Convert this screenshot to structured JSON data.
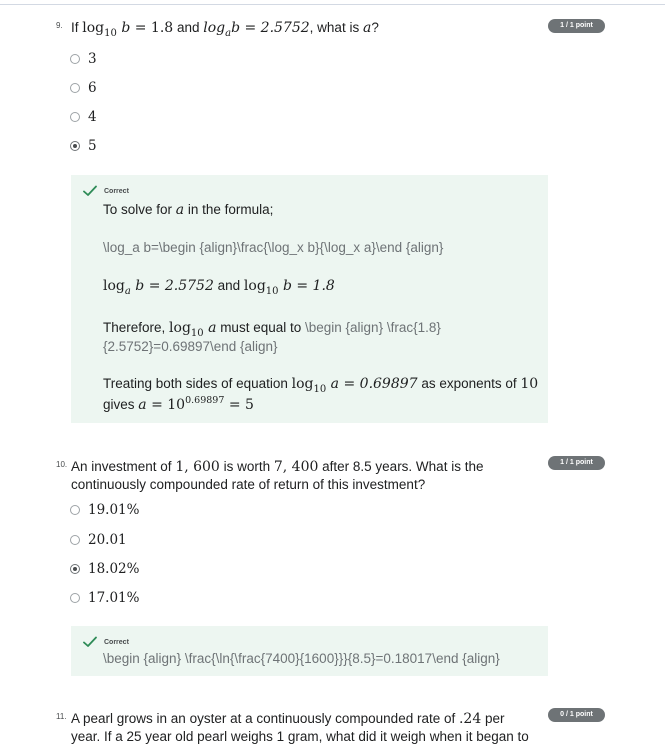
{
  "q9": {
    "number": "9.",
    "text_if": "If ",
    "log": "log",
    "sub10": "10",
    "b": "b",
    "eq1": " = 1.8",
    "and": " and ",
    "log_italic": "log",
    "sub_a": "a",
    "eq2": "b = 2.5752",
    "tail": ", what is ",
    "a": "a",
    "q": "?",
    "badge": "1 / 1 point",
    "options": [
      {
        "label": "3",
        "selected": false
      },
      {
        "label": "6",
        "selected": false
      },
      {
        "label": "4",
        "selected": false
      },
      {
        "label": "5",
        "selected": true
      }
    ],
    "feedback": {
      "status": "Correct",
      "line1_pre": "To solve for ",
      "line1_var": "a",
      "line1_post": " in the formula;",
      "line2": "\\log_a b=\\begin {align}\\frac{\\log_x b}{\\log_x a}\\end {align}",
      "line3_a_log": "log",
      "line3_a_sub": "a",
      "line3_a_rest": " b = 2.5752",
      "line3_and": " and ",
      "line3_b_log": "log",
      "line3_b_sub": "10",
      "line3_b_rest": " b = 1.8",
      "line4_pre": "Therefore, ",
      "line4_log": "log",
      "line4_sub": "10",
      "line4_var": " a",
      "line4_mid": " must equal to ",
      "line4_latex_a": "\\begin {align} \\frac{1.8}",
      "line4_latex_b": "{2.5752}=0.69897\\end {align}",
      "line5_pre": "Treating both sides of equation ",
      "line5_log": "log",
      "line5_sub": "10",
      "line5_eq": " a = 0.69897",
      "line5_mid": " as exponents of ",
      "line5_ten": "10",
      "line6_pre": "gives ",
      "line6_a": "a",
      "line6_eq": " = 10",
      "line6_exp": "0.69897",
      "line6_end": " = 5"
    }
  },
  "q10": {
    "number": "10.",
    "line1_pre": "An investment of ",
    "amount1": "1, 600",
    "line1_mid": " is worth ",
    "amount2": "7, 400",
    "line1_post": " after 8.5 years. What is the",
    "line2": "continuously compounded rate of return of this investment?",
    "badge": "1 / 1 point",
    "options": [
      {
        "label": "19.01%",
        "selected": false
      },
      {
        "label": "20.01",
        "selected": false
      },
      {
        "label": "18.02%",
        "selected": true
      },
      {
        "label": "17.01%",
        "selected": false
      }
    ],
    "feedback": {
      "status": "Correct",
      "line1": "\\begin {align} \\frac{\\ln{\\frac{7400}{1600}}}{8.5}=0.18017\\end {align}"
    }
  },
  "q11": {
    "number": "11.",
    "line1_pre": "A pearl grows in an oyster at a continuously compounded rate of ",
    "rate": ".24",
    "line1_post": " per",
    "line2": "year. If a 25 year old pearl weighs 1 gram, what did it weigh when it began to",
    "badge": "0 / 1 point"
  }
}
